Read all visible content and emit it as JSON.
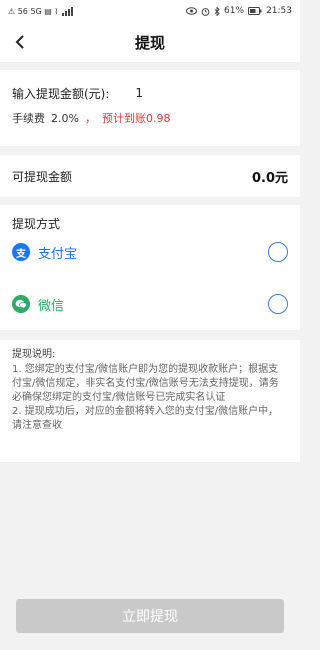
{
  "status_bar": {
    "left_glyphs": "⚠ 56 5G ▤ ⌇",
    "battery": "61%",
    "time": "21:53",
    "icons": [
      "eye-icon",
      "alarm-icon",
      "bluetooth-icon",
      "battery-icon"
    ]
  },
  "header": {
    "back_icon": "chevron-left-icon",
    "title": "提现"
  },
  "amount_card": {
    "amount_label": "输入提现金额(元):",
    "amount_value": "1",
    "fee_label": "手续费",
    "fee_rate": "2.0%",
    "separator": "，",
    "estimated": "预计到账0.98",
    "estimated_color": "#e53935"
  },
  "balance_card": {
    "label": "可提现金额",
    "value": "0.0元"
  },
  "methods_card": {
    "title": "提现方式",
    "methods": [
      {
        "name": "支付宝",
        "icon": "alipay-icon",
        "icon_glyph": "支",
        "color": "#1677ff",
        "selected": false
      },
      {
        "name": "微信",
        "icon": "wechat-icon",
        "icon_glyph": "●",
        "color": "#2aae67",
        "selected": false
      }
    ]
  },
  "notes": {
    "title": "提现说明:",
    "lines": [
      "1. 您绑定的支付宝/微信账户即为您的提现收款账户；根据支付宝/微信规定，非实名支付宝/微信账号无法支持提现，请务必确保您绑定的支付宝/微信账号已完成实名认证",
      "2. 提现成功后，对应的金额将转入您的支付宝/微信账户中，请注意查收"
    ]
  },
  "submit": {
    "label": "立即提现"
  },
  "colors": {
    "accent": "#3a7ed8",
    "button_disabled": "#c9c9c9",
    "background": "#f2f2f2"
  }
}
